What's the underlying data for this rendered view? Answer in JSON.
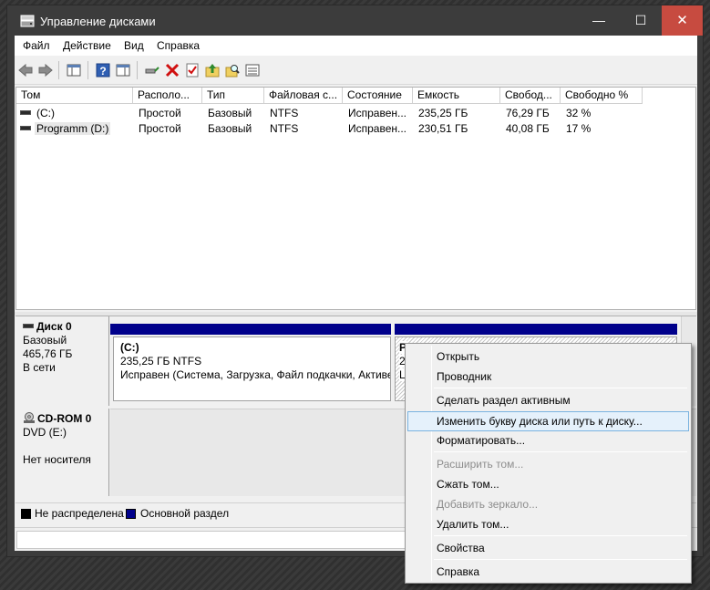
{
  "window": {
    "title": "Управление дисками",
    "minimize": "—",
    "maximize": "☐",
    "close": "✕"
  },
  "menu": [
    "Файл",
    "Действие",
    "Вид",
    "Справка"
  ],
  "toolbar_icons": [
    "back-arrow-icon",
    "forward-arrow-icon",
    "console-tree-icon",
    "help-icon",
    "properties-icon",
    "connect-icon",
    "delete-icon",
    "check-icon",
    "up-folder-icon",
    "search-folder-icon",
    "list-view-icon"
  ],
  "volumes": {
    "columns": [
      "Том",
      "Располо...",
      "Тип",
      "Файловая с...",
      "Состояние",
      "Емкость",
      "Свобод...",
      "Свободно %"
    ],
    "rows": [
      [
        "(C:)",
        "Простой",
        "Базовый",
        "NTFS",
        "Исправен...",
        "235,25 ГБ",
        "76,29 ГБ",
        "32 %"
      ],
      [
        "Programm (D:)",
        "Простой",
        "Базовый",
        "NTFS",
        "Исправен...",
        "230,51 ГБ",
        "40,08 ГБ",
        "17 %"
      ]
    ]
  },
  "disks": [
    {
      "name": "Диск 0",
      "type": "Базовый",
      "size": "465,76 ГБ",
      "status": "В сети",
      "partition_c": {
        "label": "(C:)",
        "size_fs": "235,25 ГБ NTFS",
        "status": "Исправен (Система, Загрузка, Файл подкачки, Активе"
      },
      "partition_d_fragments": [
        "P",
        "2",
        "L"
      ]
    },
    {
      "name": "CD-ROM 0",
      "type": "DVD (E:)",
      "status": "Нет носителя"
    }
  ],
  "legend": [
    {
      "label": "Не распределена",
      "color": "#000000"
    },
    {
      "label": "Основной раздел",
      "color": "#00008b"
    }
  ],
  "context_menu": [
    {
      "label": "Открыть",
      "enabled": true
    },
    {
      "label": "Проводник",
      "enabled": true
    },
    {
      "label": "Сделать раздел активным",
      "enabled": true
    },
    {
      "label": "Изменить букву диска или путь к диску...",
      "enabled": true,
      "highlighted": true
    },
    {
      "label": "Форматировать...",
      "enabled": true
    },
    {
      "label": "Расширить том...",
      "enabled": false
    },
    {
      "label": "Сжать том...",
      "enabled": true
    },
    {
      "label": "Добавить зеркало...",
      "enabled": false
    },
    {
      "label": "Удалить том...",
      "enabled": true
    },
    {
      "label": "Свойства",
      "enabled": true
    },
    {
      "label": "Справка",
      "enabled": true
    }
  ]
}
